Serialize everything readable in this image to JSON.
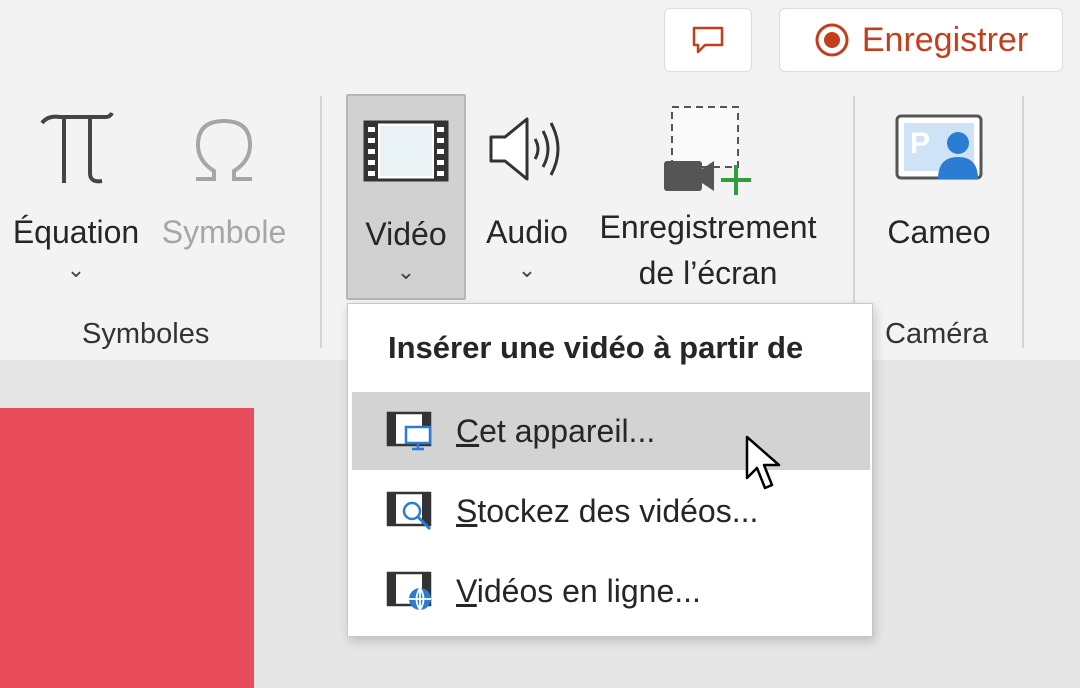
{
  "top_buttons": {
    "comment_icon": "comment-icon",
    "record_icon": "record-icon",
    "record_label": "Enregistrer"
  },
  "ribbon": {
    "groups": [
      {
        "label": "Symboles"
      },
      {
        "label": "Caméra"
      }
    ],
    "buttons": {
      "equation": {
        "label": "Équation",
        "icon": "pi-icon"
      },
      "symbole": {
        "label": "Symbole",
        "icon": "omega-icon"
      },
      "video": {
        "label": "Vidéo",
        "icon": "film-icon"
      },
      "audio": {
        "label": "Audio",
        "icon": "speaker-icon"
      },
      "screen_recording": {
        "label_line1": "Enregistrement",
        "label_line2": "de l’écran",
        "icon": "screen-record-icon"
      },
      "cameo": {
        "label": "Cameo",
        "icon": "cameo-icon"
      }
    }
  },
  "video_menu": {
    "title": "Insérer une vidéo à partir de",
    "items": [
      {
        "accel": "C",
        "rest": "et appareil...",
        "icon": "device-video-icon"
      },
      {
        "accel": "S",
        "rest": "tockez des vidéos...",
        "icon": "stock-video-icon"
      },
      {
        "accel": "V",
        "rest": "idéos en ligne...",
        "icon": "online-video-icon"
      }
    ]
  },
  "colors": {
    "record_red": "#c43e1c",
    "slide_shape": "#e94c5b",
    "accent_blue": "#2b7cd3",
    "accent_green": "#2e9e3a"
  }
}
